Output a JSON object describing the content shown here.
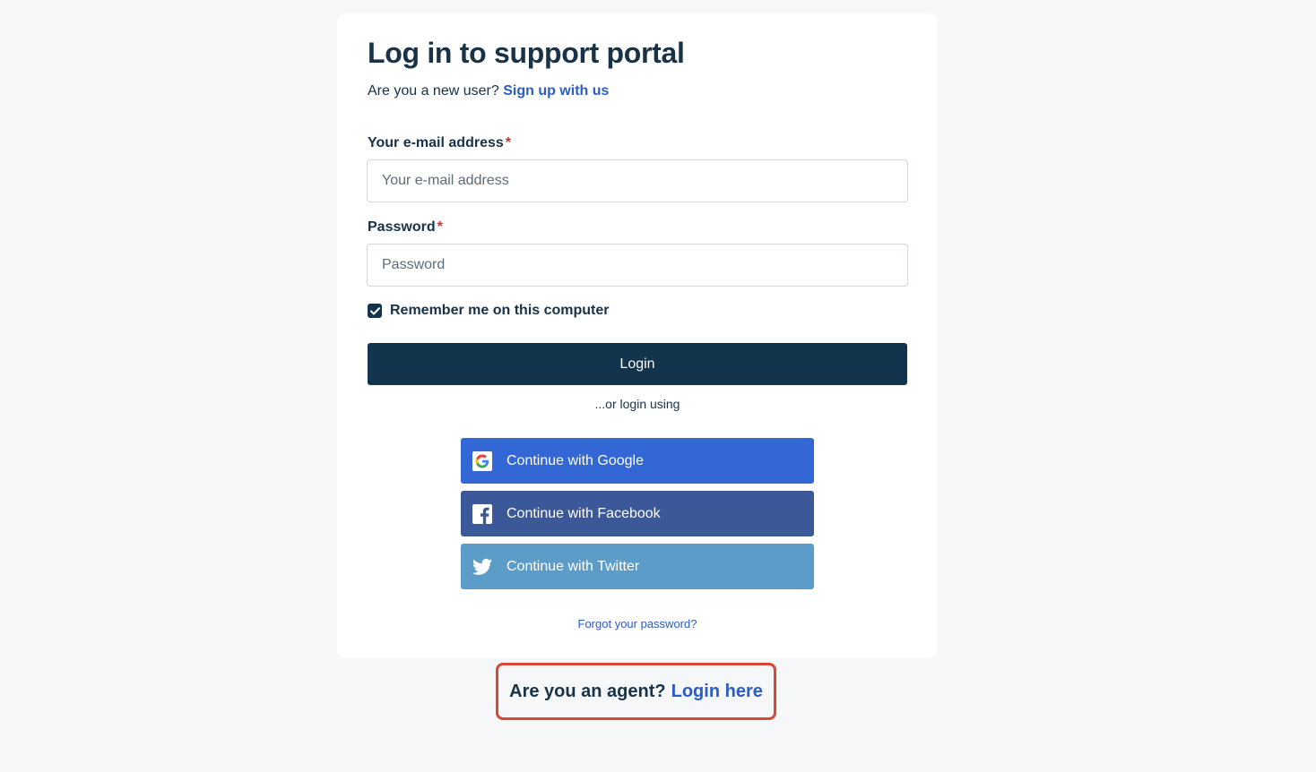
{
  "login": {
    "title": "Log in to support portal",
    "new_user_text": "Are you a new user?",
    "signup_link": "Sign up with us",
    "email": {
      "label": "Your e-mail address",
      "required_mark": "*",
      "placeholder": "Your e-mail address",
      "value": ""
    },
    "password": {
      "label": "Password",
      "required_mark": "*",
      "placeholder": "Password",
      "value": ""
    },
    "remember": {
      "label": "Remember me on this computer",
      "checked": true
    },
    "login_button": "Login",
    "or_text": "...or login using",
    "social": [
      {
        "label": "Continue with Google",
        "icon": "google-icon",
        "color": "#3367d6"
      },
      {
        "label": "Continue with Facebook",
        "icon": "facebook-icon",
        "color": "#3b5998"
      },
      {
        "label": "Continue with Twitter",
        "icon": "twitter-icon",
        "color": "#5b9dc8"
      }
    ],
    "forgot_password": "Forgot your password?"
  },
  "agent": {
    "question": "Are you an agent?",
    "link": "Login here",
    "highlight_color": "#d54936"
  },
  "colors": {
    "primary": "#12344d",
    "link": "#2c5cc5",
    "background": "#f5f7f9"
  }
}
